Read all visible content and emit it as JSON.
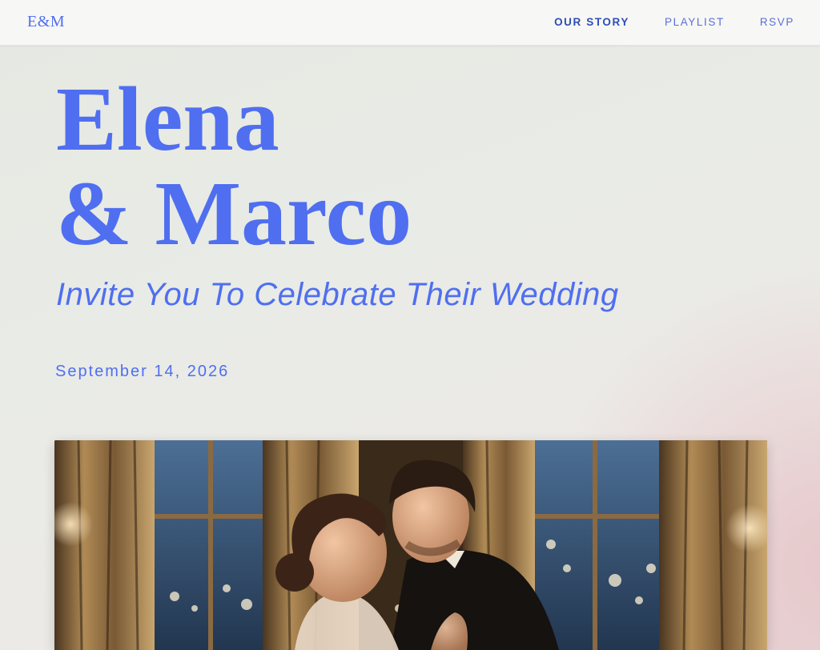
{
  "brand": {
    "logo_text": "E&M"
  },
  "nav": {
    "items": [
      {
        "label": "OUR STORY",
        "active": true
      },
      {
        "label": "PLAYLIST",
        "active": false
      },
      {
        "label": "RSVP",
        "active": false
      }
    ]
  },
  "hero": {
    "name_line1": "Elena",
    "name_line2": "& Marco",
    "subtitle": "Invite You To Celebrate Their Wedding",
    "date": "September 14, 2026"
  },
  "colors": {
    "accent": "#4f6ff0",
    "nav_active": "#2f4db8",
    "nav_bg": "#f7f7f5"
  },
  "photo": {
    "icon": "couple-photo"
  }
}
